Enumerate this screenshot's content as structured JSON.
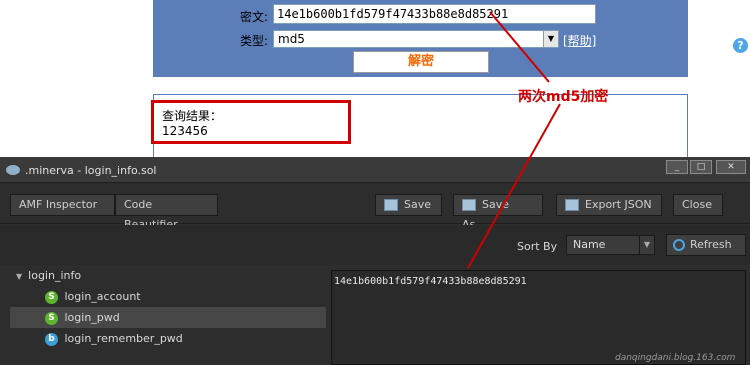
{
  "web": {
    "cipher_label": "密文:",
    "cipher_value": "14e1b600b1fd579f47433b88e8d85291",
    "type_label": "类型:",
    "type_value": "md5",
    "help_link": "[帮助]",
    "decrypt_button": "解密",
    "result_title": "查询结果：",
    "result_value": "123456"
  },
  "annotation": {
    "text": "两次md5加密",
    "color": "#d00000"
  },
  "app": {
    "window_title": ".minerva - login_info.sol",
    "tabs": [
      {
        "label": "AMF Inspector"
      },
      {
        "label": "Code Beautifier"
      }
    ],
    "toolbar": {
      "save": "Save",
      "save_as": "Save As...",
      "export_json": "Export JSON",
      "close": "Close",
      "help_icon": "?"
    },
    "sort": {
      "label": "Sort By",
      "selected": "Name",
      "refresh": "Refresh"
    },
    "tree": {
      "root": "login_info",
      "items": [
        {
          "type_badge": "S",
          "label": "login_account",
          "icon": "string-type-icon"
        },
        {
          "type_badge": "S",
          "label": "login_pwd",
          "icon": "string-type-icon",
          "selected": true
        },
        {
          "type_badge": "b",
          "label": "login_remember_pwd",
          "icon": "boolean-type-icon"
        }
      ]
    },
    "value": "14e1b600b1fd579f47433b88e8d85291"
  },
  "watermark": "danqingdani.blog.163.com",
  "colors": {
    "web_panel": "#5b7eb8",
    "decrypt_text": "#ff6600",
    "app_bg": "#2d2d2d",
    "badge_string": "#5cb52c",
    "badge_boolean": "#3aa0d8"
  }
}
